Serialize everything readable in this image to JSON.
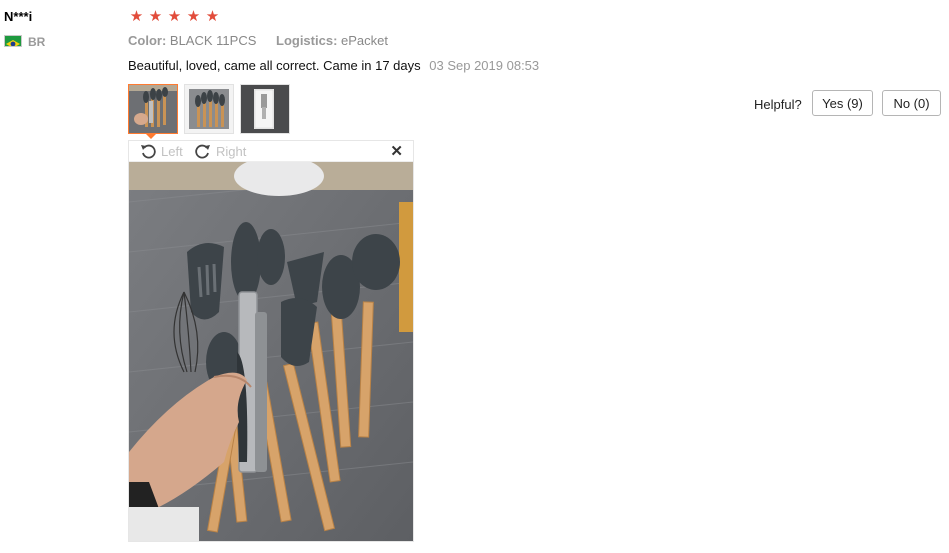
{
  "reviewer": {
    "name": "N***i",
    "country_code": "BR",
    "flag_colors": {
      "green": "#1e9a3f",
      "yellow": "#f6d10f",
      "blue": "#1d3d8f"
    }
  },
  "rating": {
    "stars": 5,
    "max": 5,
    "star_color": "#e24c3b"
  },
  "attributes": [
    {
      "label": "Color:",
      "value": "BLACK 11PCS"
    },
    {
      "label": "Logistics:",
      "value": "ePacket"
    }
  ],
  "review": {
    "text": "Beautiful, loved, came all correct. Came in 17 days",
    "date": "03 Sep 2019 08:53"
  },
  "thumbnails": [
    {
      "name": "kitchen-utensils-held",
      "active": true
    },
    {
      "name": "kitchen-utensils-set",
      "active": false
    },
    {
      "name": "package-box",
      "active": false
    }
  ],
  "viewer": {
    "rotate_left_label": "Left",
    "rotate_right_label": "Right",
    "close_icon": "close-icon",
    "image": "hand holding black silicone kitchen utensils with wooden handles on grey wood table"
  },
  "helpful": {
    "label": "Helpful?",
    "yes_label": "Yes (9)",
    "no_label": "No (0)"
  },
  "accent_color": "#ff7a30"
}
